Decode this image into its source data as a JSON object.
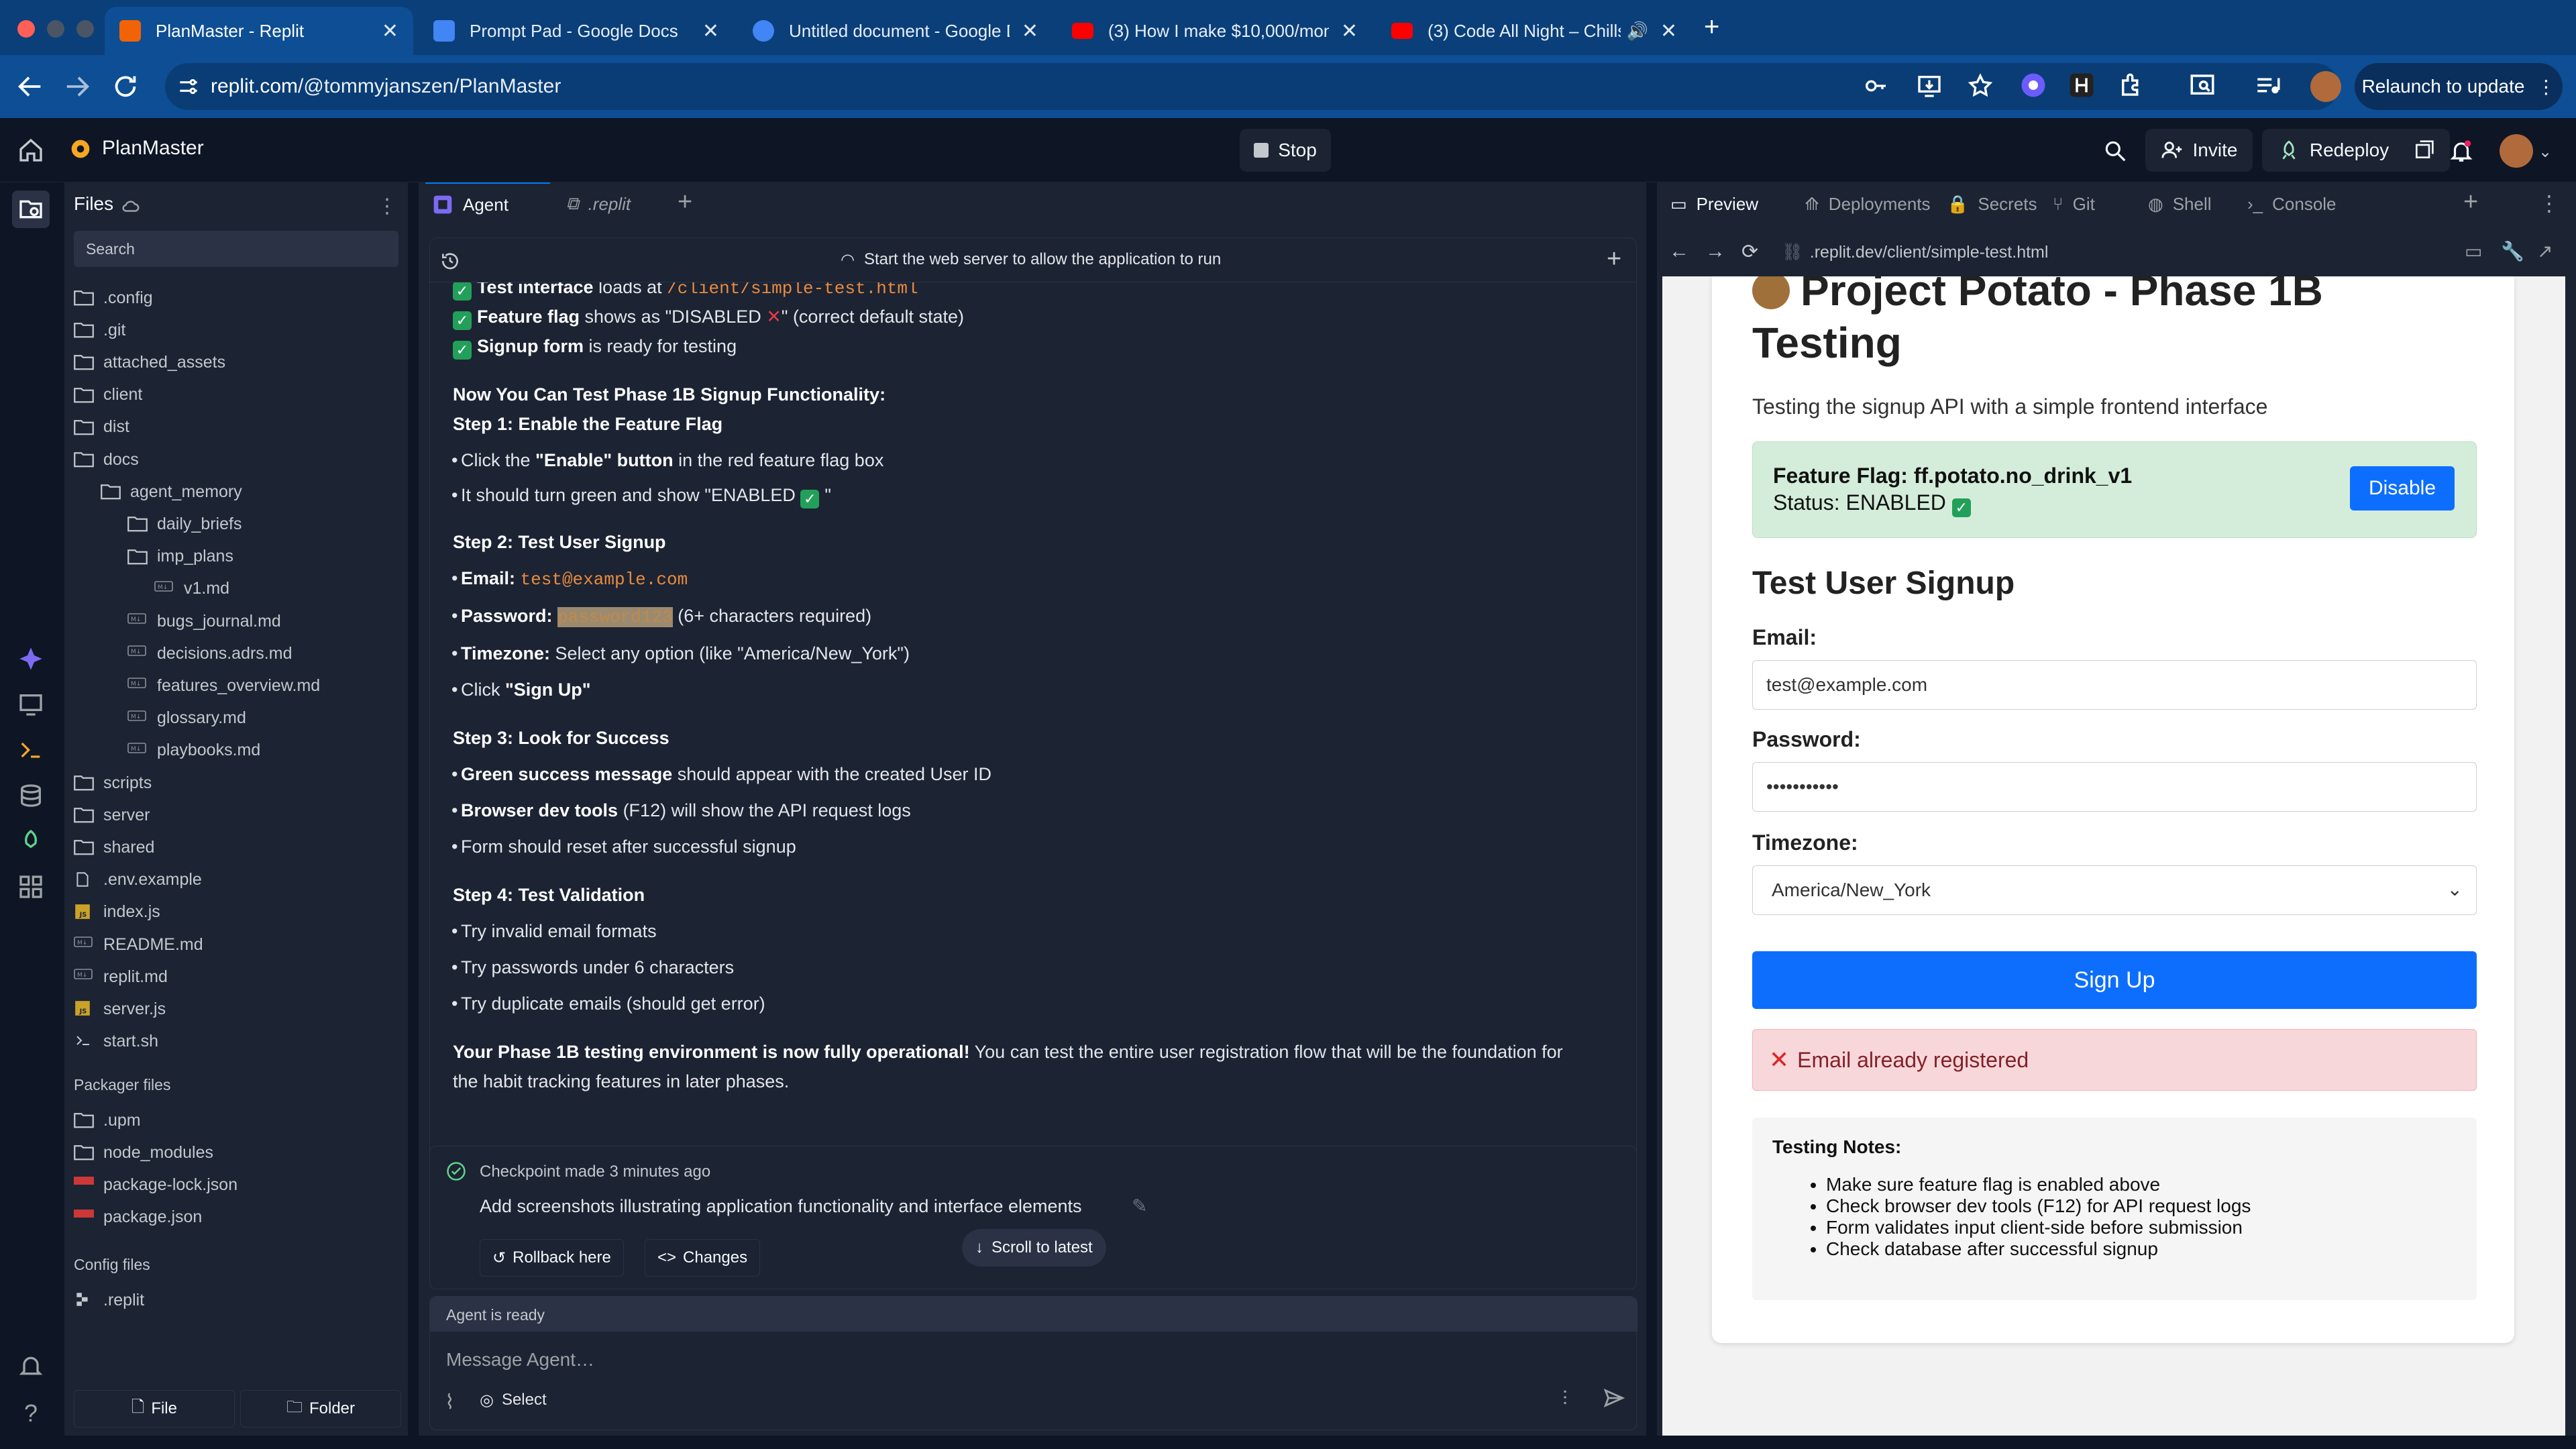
{
  "browser": {
    "tabs": [
      {
        "title": "PlanMaster - Replit",
        "fav_color": "#f26207"
      },
      {
        "title": "Prompt Pad - Google Docs",
        "fav_color": "#4285f4"
      },
      {
        "title": "Untitled document - Google D",
        "fav_color": "#4285f4"
      },
      {
        "title": "(3) How I make $10,000/mon",
        "fav_color": "#ff0000"
      },
      {
        "title": "(3) Code All Night – Chills",
        "fav_color": "#ff0000"
      }
    ],
    "url_host": "replit.com",
    "url_path": "/@tommyjanszen/PlanMaster",
    "relaunch_label": "Relaunch to update"
  },
  "header": {
    "app_name": "PlanMaster",
    "stop_label": "Stop",
    "invite_label": "Invite",
    "redeploy_label": "Redeploy"
  },
  "files": {
    "title": "Files",
    "search_placeholder": "Search",
    "tree": [
      {
        "name": ".config",
        "type": "folder",
        "depth": 0
      },
      {
        "name": ".git",
        "type": "folder",
        "depth": 0
      },
      {
        "name": "attached_assets",
        "type": "folder",
        "depth": 0
      },
      {
        "name": "client",
        "type": "folder",
        "depth": 0
      },
      {
        "name": "dist",
        "type": "folder",
        "depth": 0
      },
      {
        "name": "docs",
        "type": "folder",
        "depth": 0
      },
      {
        "name": "agent_memory",
        "type": "folder",
        "depth": 1
      },
      {
        "name": "daily_briefs",
        "type": "folder",
        "depth": 2
      },
      {
        "name": "imp_plans",
        "type": "folder",
        "depth": 2
      },
      {
        "name": "v1.md",
        "type": "md",
        "depth": 3
      },
      {
        "name": "bugs_journal.md",
        "type": "md",
        "depth": 2
      },
      {
        "name": "decisions.adrs.md",
        "type": "md",
        "depth": 2
      },
      {
        "name": "features_overview.md",
        "type": "md",
        "depth": 2
      },
      {
        "name": "glossary.md",
        "type": "md",
        "depth": 2
      },
      {
        "name": "playbooks.md",
        "type": "md",
        "depth": 2
      },
      {
        "name": "scripts",
        "type": "folder",
        "depth": 0
      },
      {
        "name": "server",
        "type": "folder",
        "depth": 0
      },
      {
        "name": "shared",
        "type": "folder",
        "depth": 0
      },
      {
        "name": ".env.example",
        "type": "file",
        "depth": 0
      },
      {
        "name": "index.js",
        "type": "js",
        "depth": 0
      },
      {
        "name": "README.md",
        "type": "md",
        "depth": 0
      },
      {
        "name": "replit.md",
        "type": "md",
        "depth": 0
      },
      {
        "name": "server.js",
        "type": "js",
        "depth": 0
      },
      {
        "name": "start.sh",
        "type": "sh",
        "depth": 0
      }
    ],
    "packager_title": "Packager files",
    "packager": [
      {
        "name": ".upm",
        "type": "folder"
      },
      {
        "name": "node_modules",
        "type": "folder"
      },
      {
        "name": "package-lock.json",
        "type": "npm"
      },
      {
        "name": "package.json",
        "type": "npm"
      }
    ],
    "config_title": "Config files",
    "config": [
      {
        "name": ".replit",
        "type": "replit"
      }
    ],
    "new_file_label": "File",
    "new_folder_label": "Folder"
  },
  "center": {
    "tab_agent": "Agent",
    "tab_replit": ".replit",
    "banner": "Start the web server to allow the application to run",
    "lines": {
      "l1_bold": "Test interface",
      "l1_text": " loads at ",
      "l1_code": "/client/simple-test.html",
      "l2_bold": "Feature flag",
      "l2_text": " shows as \"DISABLED ",
      "l2_after": "\" (correct default state)",
      "l3_bold": "Signup form",
      "l3_text": " is ready for testing",
      "h_now": "Now You Can Test Phase 1B Signup Functionality:",
      "s1": "Step 1: Enable the Feature Flag",
      "s1_b1_pre": "Click the ",
      "s1_b1_bold": "\"Enable\" button",
      "s1_b1_post": " in the red feature flag box",
      "s1_b2": "It should turn green and show \"ENABLED ",
      "s1_b2_end": "\"",
      "s2": "Step 2: Test User Signup",
      "s2_email_label": "Email:",
      "s2_email": "test@example.com",
      "s2_pw_label": "Password:",
      "s2_pw": "password123",
      "s2_pw_note": " (6+ characters required)",
      "s2_tz_label": "Timezone:",
      "s2_tz": " Select any option (like \"America/New_York\")",
      "s2_click": "Click ",
      "s2_signup": "\"Sign Up\"",
      "s3": "Step 3: Look for Success",
      "s3_b1_bold": "Green success message",
      "s3_b1": " should appear with the created User ID",
      "s3_b2_bold": "Browser dev tools",
      "s3_b2": " (F12) will show the API request logs",
      "s3_b3": "Form should reset after successful signup",
      "s4": "Step 4: Test Validation",
      "s4_b1": "Try invalid email formats",
      "s4_b2": "Try passwords under 6 characters",
      "s4_b3": "Try duplicate emails (should get error)",
      "final_bold": "Your Phase 1B testing environment is now fully operational!",
      "final_text": " You can test the entire user registration flow that will be the foundation for",
      "final_text2": "the habit tracking features in later phases."
    },
    "checkpoint_label": "Checkpoint made 3 minutes ago",
    "checkpoint_desc": "Add screenshots illustrating application functionality and interface elements",
    "rollback_label": "Rollback here",
    "changes_label": "Changes",
    "scroll_label": "Scroll to latest",
    "status": "Agent is ready",
    "message_placeholder": "Message Agent…",
    "select_label": "Select"
  },
  "right": {
    "tabs": [
      "Preview",
      "Deployments",
      "Secrets",
      "Git",
      "Shell",
      "Console"
    ],
    "url": ".replit.dev/client/simple-test.html",
    "page": {
      "title_line1": "Project Potato - Phase 1B",
      "title_line2": "Testing",
      "subtitle": "Testing the signup API with a simple frontend interface",
      "flag_name": "Feature Flag: ff.potato.no_drink_v1",
      "flag_status": "Status: ENABLED",
      "disable_label": "Disable",
      "form_title": "Test User Signup",
      "email_label": "Email:",
      "email_value": "test@example.com",
      "password_label": "Password:",
      "password_value": "•••••••••••",
      "timezone_label": "Timezone:",
      "timezone_value": "America/New_York",
      "signup_label": "Sign Up",
      "error": "Email already registered",
      "notes_title": "Testing Notes:",
      "notes": [
        "Make sure feature flag is enabled above",
        "Check browser dev tools (F12) for API request logs",
        "Form validates input client-side before submission",
        "Check database after successful signup"
      ]
    }
  },
  "colors": {
    "accent": "#0d6efd",
    "ok": "#22a05a",
    "error": "#f8d7da",
    "flag_bg": "#d4edda"
  }
}
